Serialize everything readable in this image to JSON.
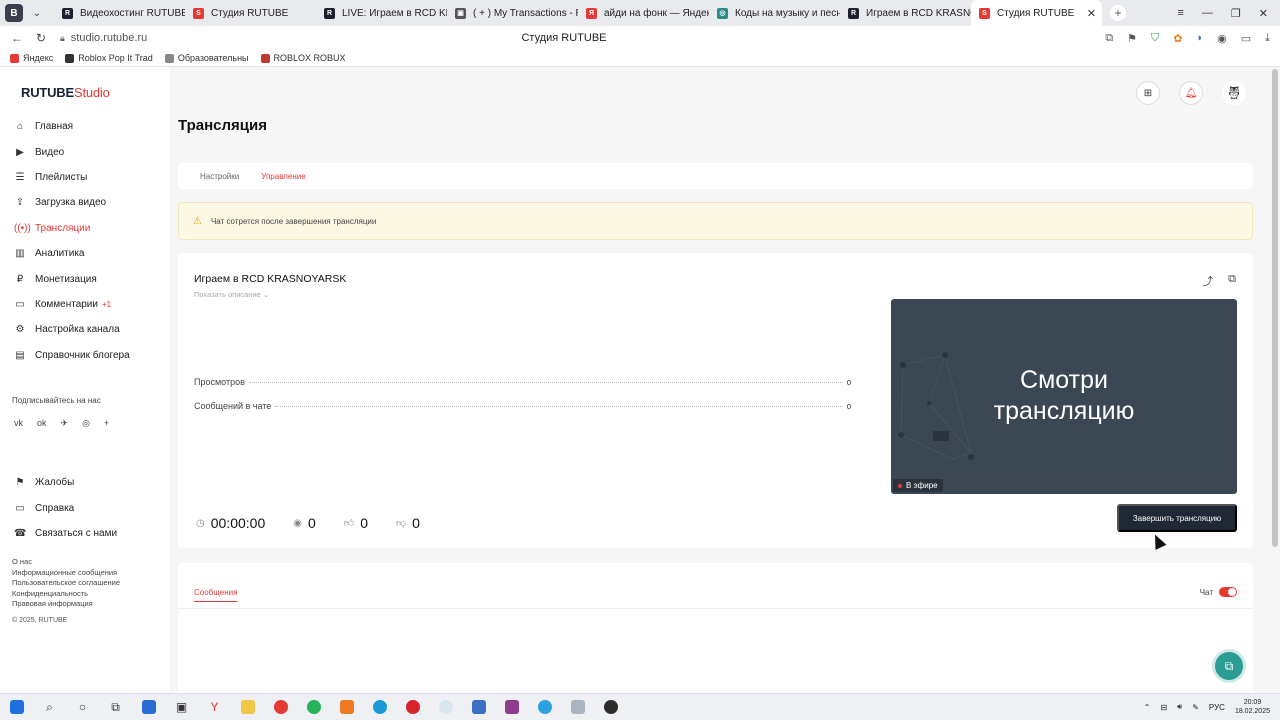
{
  "browser": {
    "tabs": [
      {
        "label": "Видеохостинг RUTUBE. С",
        "color": "#1b2130",
        "glyph": "R"
      },
      {
        "label": "Студия RUTUBE",
        "color": "#e53935",
        "glyph": "S"
      },
      {
        "label": "LIVE: Играем в RCD KRAS",
        "color": "#1b2130",
        "glyph": "R"
      },
      {
        "label": "( + ) My Transactions - Ro",
        "color": "#555555",
        "glyph": "▣"
      },
      {
        "label": "айди на фонк — Яндекс: н",
        "color": "#e53935",
        "glyph": "Я"
      },
      {
        "label": "Коды на музыку и песни",
        "color": "#2c8c8c",
        "glyph": "◎"
      },
      {
        "label": "Играем в RCD KRASNOY",
        "color": "#1b2130",
        "glyph": "R"
      },
      {
        "label": "Студия RUTUBE",
        "color": "#e53935",
        "glyph": "S",
        "active": true
      }
    ],
    "url": "studio.rutube.ru",
    "page_title": "Студия RUTUBE",
    "bookmarks": [
      {
        "label": "Яндекс",
        "color": "#e53935"
      },
      {
        "label": "Roblox Pop It Trad",
        "color": "#333333"
      },
      {
        "label": "Образовательны",
        "color": "#888888"
      },
      {
        "label": "ROBLOX ROBUX",
        "color": "#c0392b"
      }
    ]
  },
  "sidebar": {
    "logo_main": "RUTUBE",
    "logo_sub": "Studio",
    "items": [
      {
        "label": "Главная",
        "icon": "⌂"
      },
      {
        "label": "Видео",
        "icon": "▶"
      },
      {
        "label": "Плейлисты",
        "icon": "☰"
      },
      {
        "label": "Загрузка видео",
        "icon": "⇪"
      },
      {
        "label": "Трансляции",
        "icon": "((•))",
        "active": true
      },
      {
        "label": "Аналитика",
        "icon": "▥"
      },
      {
        "label": "Монетизация",
        "icon": "₽"
      },
      {
        "label": "Комментарии",
        "icon": "▭",
        "badge": "+1"
      },
      {
        "label": "Настройка канала",
        "icon": "⚙"
      },
      {
        "label": "Справочник блогера",
        "icon": "▤"
      }
    ],
    "subscribe_label": "Подписывайтесь на нас",
    "socials": [
      "vk",
      "ok",
      "✈",
      "◎",
      "+"
    ],
    "support": [
      {
        "label": "Жалобы",
        "icon": "⚑"
      },
      {
        "label": "Справка",
        "icon": "▭"
      },
      {
        "label": "Связаться с нами",
        "icon": "☎"
      }
    ],
    "footer_links": [
      "О нас",
      "Информационные сообщения",
      "Пользовательское соглашение",
      "Конфиденциальность",
      "Правовая информация"
    ],
    "copyright": "© 2025, RUTUBE"
  },
  "page": {
    "title": "Трансляция",
    "tabs": [
      "Настройки",
      "Управление"
    ],
    "active_tab": 1,
    "alert": "Чат сотрется после завершения трансляции",
    "stream": {
      "title": "Играем в RCD KRASNOYARSK",
      "show_description": "Показать описание ⌄",
      "stats": [
        {
          "label": "Просмотров",
          "value": "0"
        },
        {
          "label": "Сообщений в чате",
          "value": "0"
        }
      ],
      "preview_text_line1": "Смотри",
      "preview_text_line2": "трансляцию",
      "on_air": "В эфире",
      "duration": "00:00:00",
      "viewers": "0",
      "likes": "0",
      "dislikes": "0",
      "end_button": "Завершить трансляцию"
    },
    "messages_tab": "Сообщения",
    "chat_label": "Чат",
    "chat_enabled": true
  },
  "taskbar": {
    "time": "20:09",
    "date": "18.02.2025",
    "lang": "РУС"
  }
}
